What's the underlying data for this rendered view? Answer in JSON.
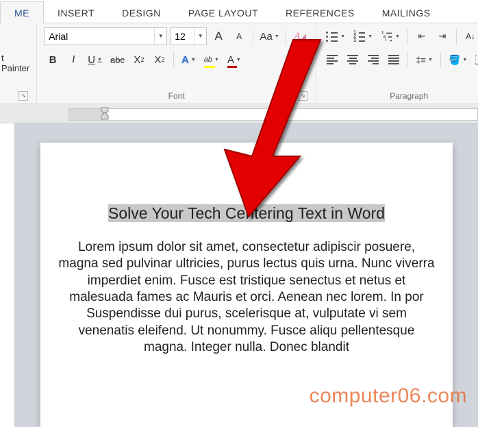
{
  "tabs": {
    "home": "ME",
    "insert": "INSERT",
    "design": "DESIGN",
    "page_layout": "PAGE LAYOUT",
    "references": "REFERENCES",
    "mailings": "MAILINGS"
  },
  "clipboard": {
    "format_painter": "t Painter"
  },
  "font": {
    "group_label": "Font",
    "name": "Arial",
    "size": "12",
    "grow_label": "A",
    "shrink_label": "A",
    "case_label": "Aa",
    "bold": "B",
    "italic": "I",
    "underline": "U",
    "strike": "abc",
    "subscript": "X",
    "superscript": "X",
    "text_effects": "A",
    "highlight": "ab",
    "font_color": "A"
  },
  "paragraph": {
    "group_label": "Paragraph",
    "sort_label": "A↓",
    "spacing_label": "‡≡"
  },
  "document": {
    "title": "Solve Your Tech Centering Text in Word",
    "body": "Lorem ipsum dolor sit amet, consectetur adipiscir posuere, magna sed pulvinar ultricies, purus lectus quis urna. Nunc viverra imperdiet enim. Fusce est tristique senectus et netus et malesuada fames ac Mauris et orci. Aenean nec lorem. In por Suspendisse dui purus, scelerisque at, vulputate vi sem venenatis eleifend. Ut nonummy. Fusce aliqu pellentesque magna. Integer nulla. Donec blandit"
  },
  "watermark": "computer06.com"
}
